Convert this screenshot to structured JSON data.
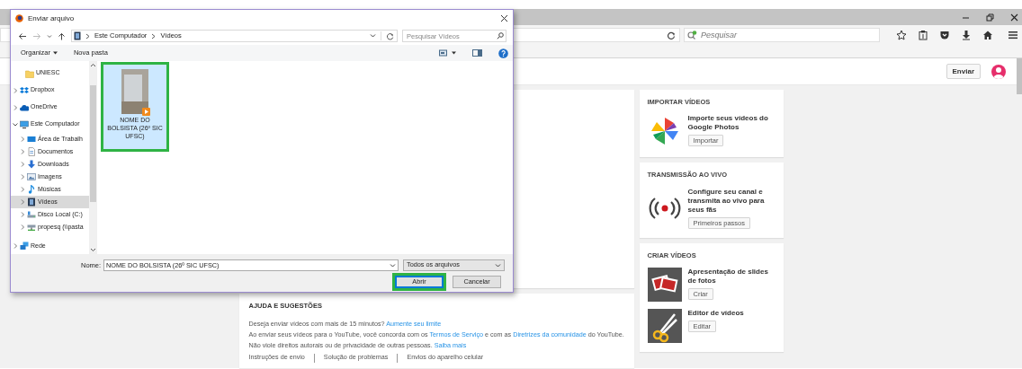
{
  "browser": {
    "search_placeholder": "Pesquisar"
  },
  "header": {
    "upload_button": "Enviar"
  },
  "sidebar_cards": [
    {
      "title": "IMPORTAR VÍDEOS",
      "items": [
        {
          "kind": "photos",
          "text": "Importe seus vídeos do Google Photos",
          "button": "Importar"
        }
      ]
    },
    {
      "title": "TRANSMISSÃO AO VIVO",
      "items": [
        {
          "kind": "live",
          "text": "Configure seu canal e transmita ao vivo para seus fãs",
          "button": "Primeiros passos"
        }
      ]
    },
    {
      "title": "CRIAR VÍDEOS",
      "items": [
        {
          "kind": "slideshow",
          "text": "Apresentação de slides de fotos",
          "button": "Criar"
        },
        {
          "kind": "editor",
          "text": "Editor de vídeos",
          "button": "Editar"
        }
      ]
    }
  ],
  "help": {
    "title": "AJUDA E SUGESTÕES",
    "lines": [
      [
        {
          "text": "Deseja enviar vídeos com mais de 15 minutos?",
          "link": false
        },
        {
          "text": "Aumente seu limite",
          "link": true
        }
      ],
      [
        {
          "text": "Ao enviar seus vídeos para o YouTube, você concorda com os",
          "link": false
        },
        {
          "text": "Termos de Serviço",
          "link": true
        },
        {
          "text": "e com as",
          "link": false
        },
        {
          "text": "Diretrizes da comunidade",
          "link": true
        },
        {
          "text": "do YouTube.",
          "link": false
        }
      ],
      [
        {
          "text": "Não viole direitos autorais ou de privacidade de outras pessoas.",
          "link": false
        },
        {
          "text": "Saiba mais",
          "link": true
        }
      ]
    ],
    "footer_links": [
      "Instruções de envio",
      "Solução de problemas",
      "Envios do aparelho celular"
    ]
  },
  "dialog": {
    "title": "Enviar arquivo",
    "breadcrumb": [
      "Este Computador",
      "Vídeos"
    ],
    "search_placeholder": "Pesquisar Vídeos",
    "toolbar": {
      "organize": "Organizar",
      "new_folder": "Nova pasta"
    },
    "nav": [
      {
        "kind": "folder",
        "label": "UNIESC",
        "selected": false
      },
      {
        "kind": "dropbox",
        "label": "Dropbox",
        "expanded": false,
        "selected": false
      },
      {
        "kind": "onedrive",
        "label": "OneDrive",
        "expanded": false,
        "selected": false
      },
      {
        "kind": "computer",
        "label": "Este Computador",
        "expanded": true,
        "selected": false,
        "children": [
          {
            "kind": "desktop",
            "label": "Área de Trabalh",
            "expanded": false,
            "selected": false
          },
          {
            "kind": "documents",
            "label": "Documentos",
            "expanded": false,
            "selected": false
          },
          {
            "kind": "downloads",
            "label": "Downloads",
            "expanded": false,
            "selected": false
          },
          {
            "kind": "pictures",
            "label": "Imagens",
            "expanded": false,
            "selected": false
          },
          {
            "kind": "music",
            "label": "Músicas",
            "expanded": false,
            "selected": false
          },
          {
            "kind": "videos",
            "label": "Vídeos",
            "expanded": false,
            "selected": true
          },
          {
            "kind": "drive",
            "label": "Disco Local (C:)",
            "expanded": false,
            "selected": false
          },
          {
            "kind": "netdrive",
            "label": "propesq (\\\\pasta",
            "expanded": false,
            "selected": false
          }
        ]
      },
      {
        "kind": "network",
        "label": "Rede",
        "expanded": false,
        "selected": false
      }
    ],
    "files": [
      {
        "name": "NOME DO BOLSISTA (26º SIC UFSC)",
        "selected": true,
        "highlighted": true
      }
    ],
    "filename_label": "Nome:",
    "filename": "NOME DO BOLSISTA (26º SIC UFSC)",
    "filetype": "Todos os arquivos",
    "buttons": [
      {
        "label": "Abrir",
        "primary": true,
        "highlighted": true
      },
      {
        "label": "Cancelar",
        "primary": false,
        "highlighted": false
      }
    ]
  }
}
